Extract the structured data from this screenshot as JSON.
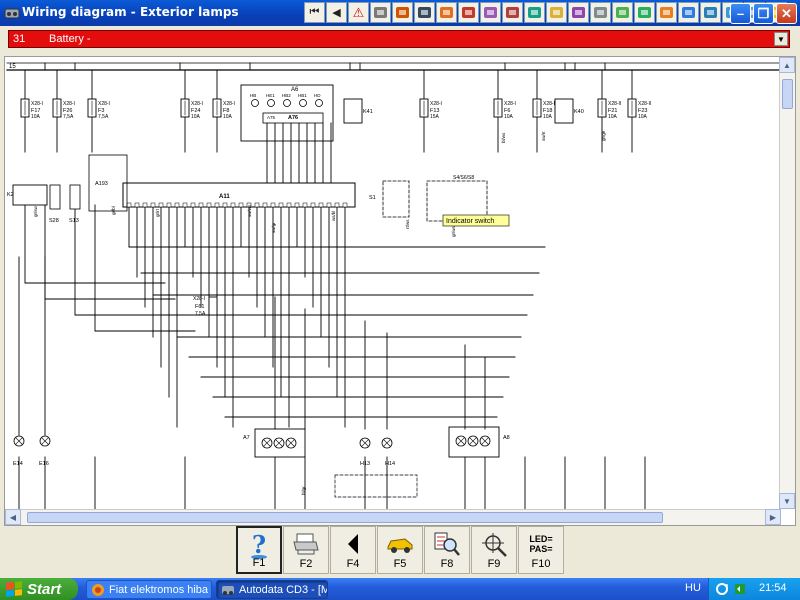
{
  "window": {
    "title": "Wiring diagram - Exterior lamps",
    "toolbar_icons": [
      "first-icon",
      "back-icon",
      "warning-icon",
      "tool-icon-1",
      "tool-icon-2",
      "tool-icon-3",
      "tool-icon-4",
      "tool-icon-5",
      "tool-icon-6",
      "tool-icon-7",
      "tool-icon-8",
      "tool-icon-9",
      "tool-icon-10",
      "tool-icon-11",
      "tool-icon-12",
      "tool-icon-13",
      "tool-icon-14",
      "tool-icon-15",
      "tool-icon-16",
      "tool-icon-17",
      "tool-icon-18",
      "tool-icon-19"
    ]
  },
  "selector": {
    "number": "31",
    "label": "Battery -"
  },
  "diagram": {
    "top_bus_label": "15",
    "fuses": [
      {
        "conn": "X28-I",
        "name": "F17",
        "rating": "10A"
      },
      {
        "conn": "X28-I",
        "name": "F26",
        "rating": "7,5A"
      },
      {
        "conn": "X28-I",
        "name": "F3",
        "rating": "7,5A"
      },
      {
        "conn": "X28-I",
        "name": "F24",
        "rating": "10A"
      },
      {
        "conn": "X28-I",
        "name": "F8",
        "rating": "10A"
      },
      {
        "conn": "X28-I",
        "name": "F13",
        "rating": "15A"
      },
      {
        "conn": "X28-I",
        "name": "F6",
        "rating": "10A"
      },
      {
        "conn": "X28-I",
        "name": "F18",
        "rating": "10A"
      },
      {
        "conn": "X28-II",
        "name": "F21",
        "rating": "10A"
      },
      {
        "conn": "X28-II",
        "name": "F23",
        "rating": "10A"
      },
      {
        "conn": "X28-I",
        "name": "F61",
        "rating": "7,5A"
      }
    ],
    "components": {
      "a6": "A6",
      "a75": "A75",
      "a76": "A76",
      "a11": "A11",
      "a193": "A193",
      "k2": "K2",
      "k41": "K41",
      "k40": "K40",
      "s1": "S1",
      "s4": "S4/S6/S8",
      "s28": "S28",
      "s13": "S13",
      "a7": "A7",
      "a8": "A8",
      "e14": "E14",
      "e16": "E16",
      "h13": "H13",
      "h14": "H14"
    },
    "a6_pins": [
      "HB",
      "HE1",
      "HB2",
      "HB1",
      "HD"
    ],
    "tooltip": "Indicator switch",
    "wire_labels": [
      "gr/sw",
      "gr/bl",
      "gr/rt",
      "sw/ws",
      "sw/gr",
      "ws/bl",
      "rt/ws",
      "gr/ws",
      "bl/ws",
      "sw/rt",
      "gr/ge",
      "bl/gr"
    ]
  },
  "fkeys": [
    {
      "key": "F1",
      "icon": "help-icon",
      "active": true
    },
    {
      "key": "F2",
      "icon": "printer-icon",
      "active": false
    },
    {
      "key": "F4",
      "icon": "back-arrow-icon",
      "active": false
    },
    {
      "key": "F5",
      "icon": "car-icon",
      "active": false
    },
    {
      "key": "F8",
      "icon": "component-search-icon",
      "active": false
    },
    {
      "key": "F9",
      "icon": "locator-icon",
      "active": false
    },
    {
      "key": "F10",
      "icon": "led-pas-icon",
      "active": false,
      "icon_text_1": "LED=",
      "icon_text_2": "PAS="
    }
  ],
  "taskbar": {
    "start": "Start",
    "tasks": [
      "Fiat elektromos hiba - ...",
      "Autodata CD3 - [Mod..."
    ],
    "lang": "HU",
    "clock": "21:54"
  },
  "colors": {
    "selector_bg": "#e40d0d",
    "tooltip_bg": "#ffff99",
    "titlebar": "#0a5bd6"
  }
}
